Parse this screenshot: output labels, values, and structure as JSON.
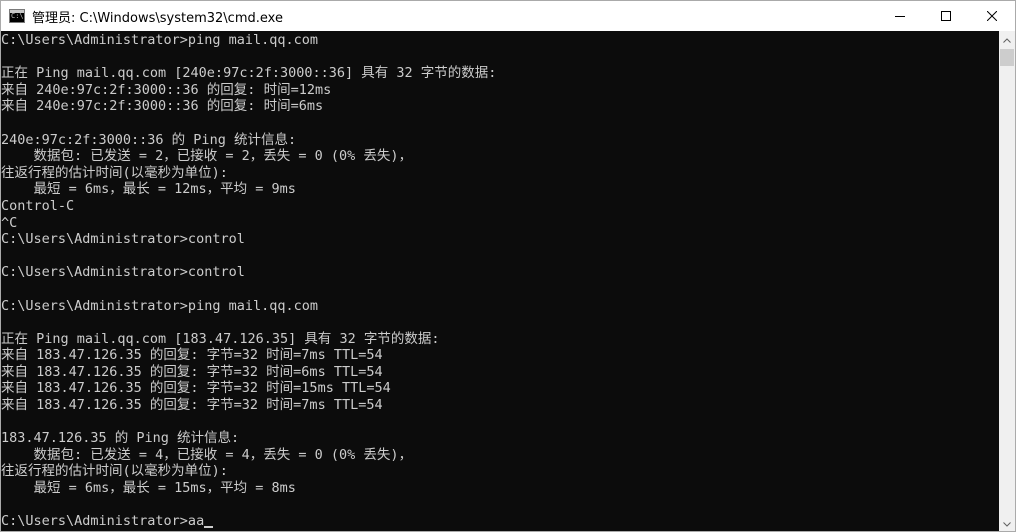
{
  "window": {
    "title": "管理员: C:\\Windows\\system32\\cmd.exe",
    "icon": "cmd-icon",
    "icon_text": "C:\\"
  },
  "controls": {
    "minimize": "minimize-icon",
    "maximize": "maximize-icon",
    "close": "close-icon"
  },
  "console": {
    "background": "#0c0c0c",
    "foreground": "#cccccc",
    "lines": [
      "C:\\Users\\Administrator>ping mail.qq.com",
      "",
      "正在 Ping mail.qq.com [240e:97c:2f:3000::36] 具有 32 字节的数据:",
      "来自 240e:97c:2f:3000::36 的回复: 时间=12ms",
      "来自 240e:97c:2f:3000::36 的回复: 时间=6ms",
      "",
      "240e:97c:2f:3000::36 的 Ping 统计信息:",
      "    数据包: 已发送 = 2，已接收 = 2，丢失 = 0 (0% 丢失)，",
      "往返行程的估计时间(以毫秒为单位):",
      "    最短 = 6ms，最长 = 12ms，平均 = 9ms",
      "Control-C",
      "^C",
      "C:\\Users\\Administrator>control",
      "",
      "C:\\Users\\Administrator>control",
      "",
      "C:\\Users\\Administrator>ping mail.qq.com",
      "",
      "正在 Ping mail.qq.com [183.47.126.35] 具有 32 字节的数据:",
      "来自 183.47.126.35 的回复: 字节=32 时间=7ms TTL=54",
      "来自 183.47.126.35 的回复: 字节=32 时间=6ms TTL=54",
      "来自 183.47.126.35 的回复: 字节=32 时间=15ms TTL=54",
      "来自 183.47.126.35 的回复: 字节=32 时间=7ms TTL=54",
      "",
      "183.47.126.35 的 Ping 统计信息:",
      "    数据包: 已发送 = 4，已接收 = 4，丢失 = 0 (0% 丢失)，",
      "往返行程的估计时间(以毫秒为单位):",
      "    最短 = 6ms，最长 = 15ms，平均 = 8ms",
      "",
      "C:\\Users\\Administrator>aa"
    ]
  },
  "scrollbar": {
    "up": "scroll-up-arrow-icon",
    "down": "scroll-down-arrow-icon"
  }
}
